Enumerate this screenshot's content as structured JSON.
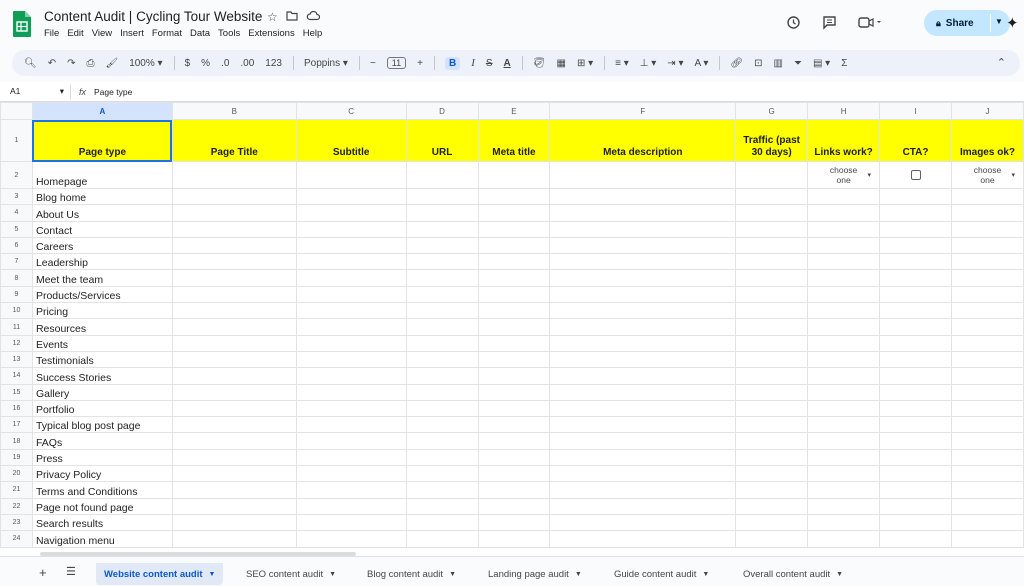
{
  "doc": {
    "title": "Content Audit | Cycling Tour Website",
    "menu": [
      "File",
      "Edit",
      "View",
      "Insert",
      "Format",
      "Data",
      "Tools",
      "Extensions",
      "Help"
    ],
    "share_label": "Share"
  },
  "toolbar": {
    "zoom": "100%",
    "currency": "$",
    "percent": "%",
    "dec_decrease": ".0",
    "dec_increase": ".00",
    "more_formats": "123",
    "font": "Poppins",
    "font_size": "11"
  },
  "formula": {
    "cell_ref": "A1",
    "value": "Page type"
  },
  "columns": [
    "A",
    "B",
    "C",
    "D",
    "E",
    "F",
    "G",
    "H",
    "I",
    "J"
  ],
  "header_row": [
    "Page type",
    "Page Title",
    "Subtitle",
    "URL",
    "Meta title",
    "Meta description",
    "Traffic (past 30 days)",
    "Links work?",
    "CTA?",
    "Images ok?"
  ],
  "row2_dropdown": "choose one",
  "page_types": [
    "Homepage",
    "Blog home",
    "About Us",
    "Contact",
    "Careers",
    "Leadership",
    "Meet the team",
    "Products/Services",
    "Pricing",
    "Resources",
    "Events",
    "Testimonials",
    "Success Stories",
    "Gallery",
    "Portfolio",
    "Typical blog post page",
    "FAQs",
    "Press",
    "Privacy Policy",
    "Terms and Conditions",
    "Page not found page",
    "Search results",
    "Navigation menu"
  ],
  "row_numbers": [
    "1",
    "2",
    "3",
    "4",
    "5",
    "6",
    "7",
    "8",
    "9",
    "10",
    "11",
    "12",
    "13",
    "14",
    "15",
    "16",
    "17",
    "18",
    "19",
    "20",
    "21",
    "22",
    "23",
    "24"
  ],
  "sheets": [
    {
      "label": "Website content audit",
      "active": true
    },
    {
      "label": "SEO content audit",
      "active": false
    },
    {
      "label": "Blog content audit",
      "active": false
    },
    {
      "label": "Landing page audit",
      "active": false
    },
    {
      "label": "Guide content audit",
      "active": false
    },
    {
      "label": "Overall content audit",
      "active": false
    }
  ],
  "colors": {
    "header_fill": "#ffff00",
    "share_bg": "#c2e7ff",
    "selection": "#1a73e8",
    "logo": "#0f9d58"
  }
}
